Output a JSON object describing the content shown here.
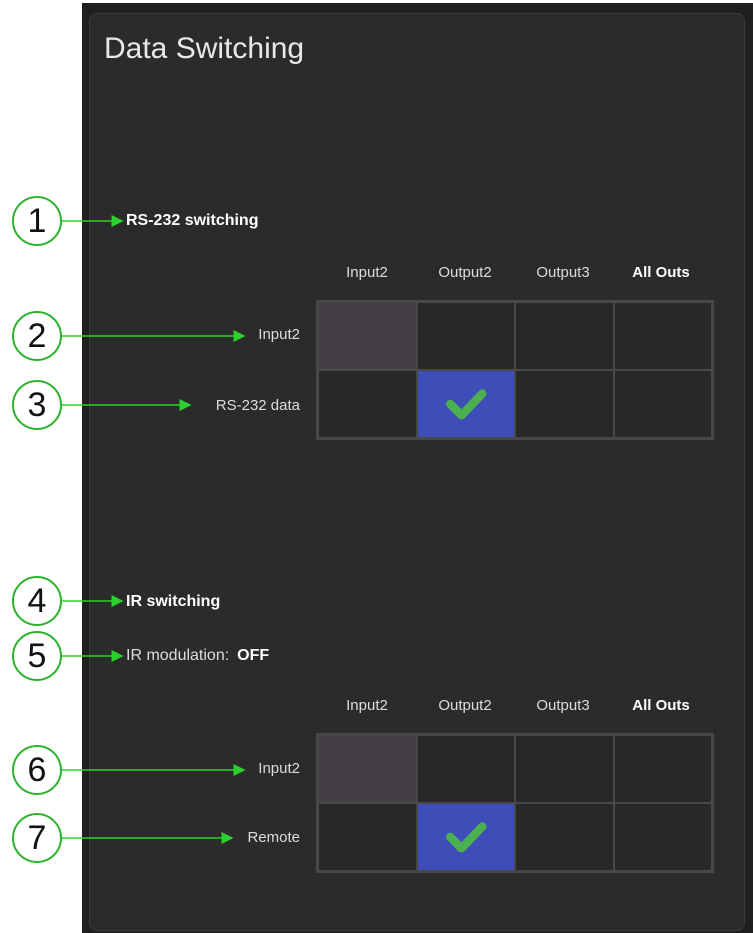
{
  "page": {
    "title": "Data Switching"
  },
  "rs232": {
    "heading": "RS-232 switching",
    "columns": [
      "Input2",
      "Output2",
      "Output3",
      "All Outs"
    ],
    "rows": [
      "Input2",
      "RS-232 data"
    ],
    "selected": {
      "row": "RS-232 data",
      "column": "Output2"
    }
  },
  "ir": {
    "heading": "IR switching",
    "modulation_label": "IR modulation:",
    "modulation_value": "OFF",
    "columns": [
      "Input2",
      "Output2",
      "Output3",
      "All Outs"
    ],
    "rows": [
      "Input2",
      "Remote"
    ],
    "selected": {
      "row": "Remote",
      "column": "Output2"
    }
  },
  "callouts": [
    "1",
    "2",
    "3",
    "4",
    "5",
    "6",
    "7"
  ],
  "icons": {
    "check": "check-icon"
  },
  "colors": {
    "selected_cell": "#3e4db8",
    "check": "#4cb050",
    "disabled_cell": "#443f45",
    "callout_border": "#2bb32b",
    "arrow": "#2bd22b"
  }
}
